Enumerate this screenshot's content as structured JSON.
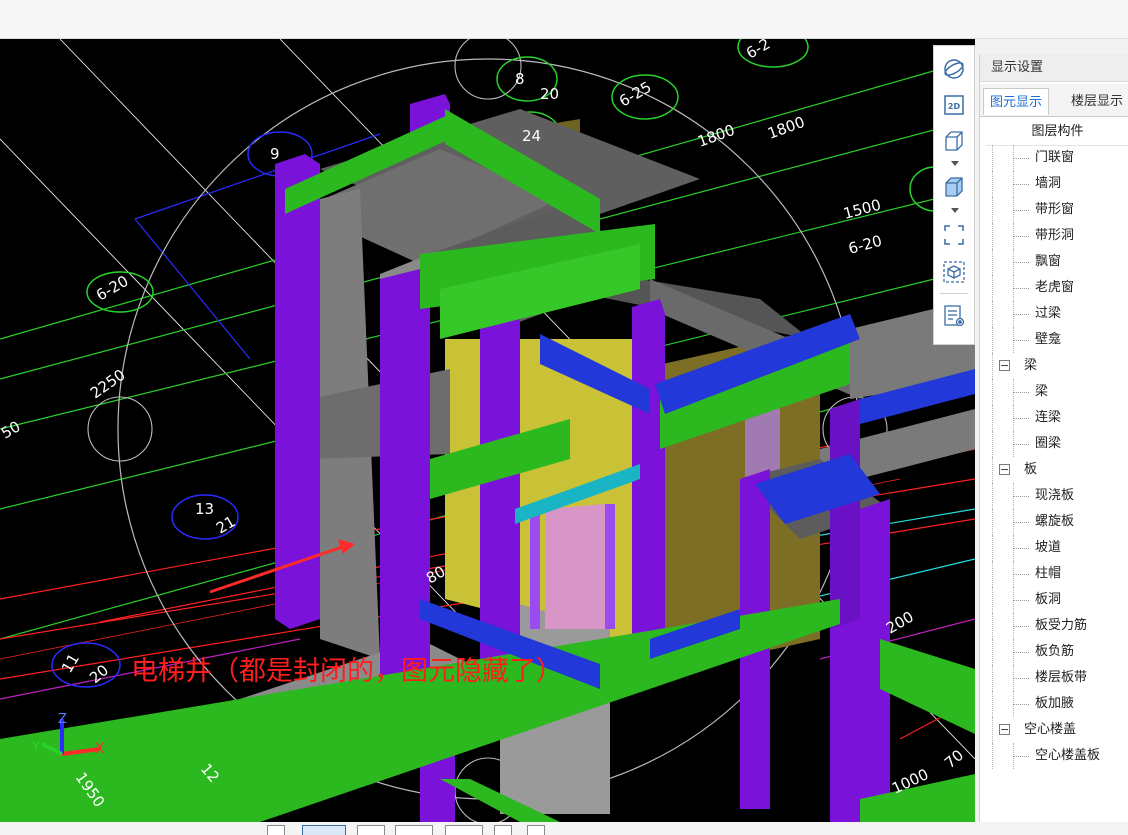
{
  "viewport": {
    "annotation_text": "电梯井（都是封闭的，图元隐藏了）",
    "axis": {
      "x": "X",
      "y": "Y",
      "z": "Z"
    },
    "cad_labels": {
      "dim_1800_a": "1800",
      "dim_1800_b": "1800",
      "dim_2250": "2250",
      "dim_200": "200",
      "dim_1000": "1000",
      "dim_1950": "1950",
      "dim_70": "70",
      "dim_50": "50",
      "circ_8": "8",
      "circ_20a": "20",
      "circ_6_25": "6-25",
      "circ_6_2x": "6-2",
      "circ_9": "9",
      "circ_6_20": "6-20",
      "circ_13": "13",
      "circ_21": "21",
      "circ_11": "11",
      "circ_20b": "20",
      "circ_24": "24",
      "text_1500": "1500",
      "text_6_20": "6-20",
      "text_80": "80",
      "text_12": "12"
    },
    "colors": {
      "background": "#000000",
      "column_purple": "#7a12d9",
      "beam_green": "#2cb81f",
      "beam_blue": "#2238d8",
      "slab_gray": "#5f5f5f",
      "wall_yellow": "#c9c236",
      "wall_olive": "#6e6320",
      "annotation_red": "#ff1d1d"
    }
  },
  "toolbar": {
    "buttons": [
      {
        "name": "orbit-icon"
      },
      {
        "name": "view-2d-icon",
        "label": "2D"
      },
      {
        "name": "view-3d-box-icon"
      },
      {
        "name": "view-3d-box-shaded-icon"
      },
      {
        "name": "fit-view-icon"
      },
      {
        "name": "cube-target-icon"
      },
      {
        "name": "display-list-icon"
      }
    ]
  },
  "panel": {
    "title": "显示设置",
    "tabs": [
      {
        "label": "图元显示",
        "active": true
      },
      {
        "label": "楼层显示",
        "active": false
      }
    ],
    "tree_header": "图层构件",
    "rows": [
      {
        "label": "门联窗",
        "type": "child"
      },
      {
        "label": "墙洞",
        "type": "child"
      },
      {
        "label": "带形窗",
        "type": "child"
      },
      {
        "label": "带形洞",
        "type": "child"
      },
      {
        "label": "飘窗",
        "type": "child"
      },
      {
        "label": "老虎窗",
        "type": "child"
      },
      {
        "label": "过梁",
        "type": "child"
      },
      {
        "label": "壁龛",
        "type": "child"
      },
      {
        "label": "梁",
        "type": "group",
        "toggle": "−"
      },
      {
        "label": "梁",
        "type": "child"
      },
      {
        "label": "连梁",
        "type": "child"
      },
      {
        "label": "圈梁",
        "type": "child"
      },
      {
        "label": "板",
        "type": "group",
        "toggle": "−"
      },
      {
        "label": "现浇板",
        "type": "child"
      },
      {
        "label": "螺旋板",
        "type": "child"
      },
      {
        "label": "坡道",
        "type": "child"
      },
      {
        "label": "柱帽",
        "type": "child"
      },
      {
        "label": "板洞",
        "type": "child"
      },
      {
        "label": "板受力筋",
        "type": "child"
      },
      {
        "label": "板负筋",
        "type": "child"
      },
      {
        "label": "楼层板带",
        "type": "child"
      },
      {
        "label": "板加腋",
        "type": "child"
      },
      {
        "label": "空心楼盖",
        "type": "group",
        "toggle": "−"
      },
      {
        "label": "空心楼盖板",
        "type": "child"
      }
    ]
  }
}
